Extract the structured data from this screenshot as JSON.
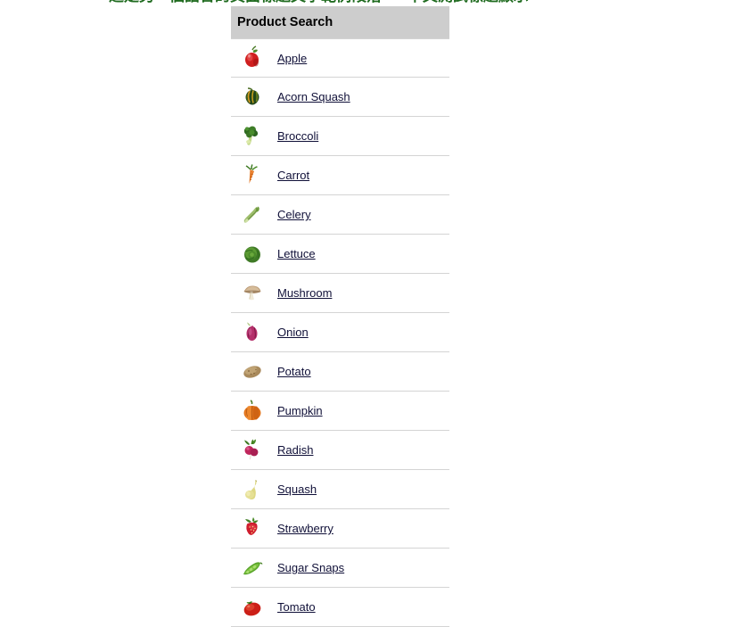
{
  "top_banner": {
    "text": "這是另一個語言的頁面標題文字範例段落 — 中文測試標題顯示",
    "color": "#1f6b1f"
  },
  "panel": {
    "header_label": "Product Search",
    "header_bg": "#cdcdcd",
    "link_color": "#101038",
    "separator_color": "#d4d4d4"
  },
  "products": [
    {
      "label": "Apple",
      "icon": "apple-icon"
    },
    {
      "label": "Acorn Squash",
      "icon": "acorn-squash-icon"
    },
    {
      "label": "Broccoli",
      "icon": "broccoli-icon"
    },
    {
      "label": "Carrot",
      "icon": "carrot-icon"
    },
    {
      "label": "Celery",
      "icon": "celery-icon"
    },
    {
      "label": "Lettuce",
      "icon": "lettuce-icon"
    },
    {
      "label": "Mushroom",
      "icon": "mushroom-icon"
    },
    {
      "label": "Onion",
      "icon": "onion-icon"
    },
    {
      "label": "Potato",
      "icon": "potato-icon"
    },
    {
      "label": "Pumpkin",
      "icon": "pumpkin-icon"
    },
    {
      "label": "Radish",
      "icon": "radish-icon"
    },
    {
      "label": "Squash",
      "icon": "squash-icon"
    },
    {
      "label": "Strawberry",
      "icon": "strawberry-icon"
    },
    {
      "label": "Sugar Snaps",
      "icon": "sugar-snaps-icon"
    },
    {
      "label": "Tomato",
      "icon": "tomato-icon"
    }
  ]
}
